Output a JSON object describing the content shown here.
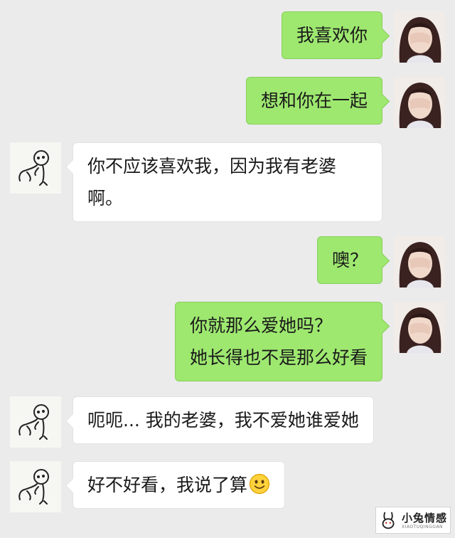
{
  "chat": {
    "messages": [
      {
        "side": "sent",
        "lines": [
          "我喜欢你"
        ]
      },
      {
        "side": "sent",
        "lines": [
          "想和你在一起"
        ]
      },
      {
        "side": "received",
        "lines": [
          "你不应该喜欢我，因为我有老婆",
          "啊。"
        ]
      },
      {
        "side": "sent",
        "lines": [
          "噢？"
        ]
      },
      {
        "side": "sent",
        "lines": [
          "你就那么爱她吗？",
          "她长得也不是那么好看"
        ]
      },
      {
        "side": "received",
        "lines": [
          "呃呃... 我的老婆，我不爱她谁爱她"
        ]
      },
      {
        "side": "received",
        "lines": [
          "好不好看，我说了算"
        ],
        "emoji": "smile-emoji"
      }
    ]
  },
  "watermark": {
    "title": "小兔情感",
    "subtitle": "XIAOTUQINGGAN"
  },
  "colors": {
    "background": "#ebebeb",
    "sent_bubble": "#9ee870",
    "received_bubble": "#ffffff"
  }
}
